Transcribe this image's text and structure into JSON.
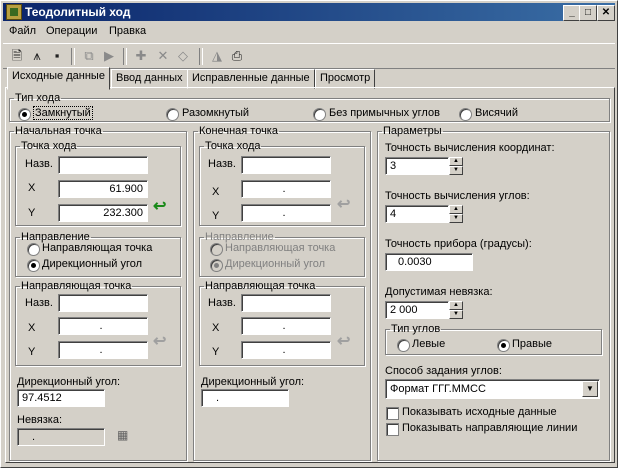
{
  "window": {
    "title": "Теодолитный ход",
    "min": "_",
    "max": "□",
    "close": "✕"
  },
  "menu": {
    "file": "Файл",
    "ops": "Операции",
    "edit": "Правка"
  },
  "toolbar": [
    "new-doc-icon",
    "instrument-icon",
    "save-icon",
    "copy-icon",
    "paste-icon",
    "add-point-icon",
    "delete-point-icon",
    "eraser-icon",
    "mirror-icon",
    "print-icon"
  ],
  "tabs": {
    "t1": "Исходные данные",
    "t2": "Ввод данных",
    "t3": "Исправленные данные",
    "t4": "Просмотр"
  },
  "course": {
    "legend": "Тип хода",
    "closed": "Замкнутый",
    "open": "Разомкнутый",
    "noangles": "Без примычных углов",
    "hanging": "Висячий",
    "selected": "closed"
  },
  "start": {
    "legend": "Начальная точка",
    "point_legend": "Точка хода",
    "name_label": "Назв.",
    "name_value": "",
    "x_label": "X",
    "x_value": "61.900",
    "y_label": "Y",
    "y_value": "232.300",
    "dir_legend": "Направление",
    "dir_guide": "Направляющая точка",
    "dir_azimuth": "Дирекционный угол",
    "guide_legend": "Направляющая точка",
    "g_name": "Назв.",
    "g_x": "X",
    "g_y": "Y",
    "g_x_value": ".",
    "g_y_value": ".",
    "azimuth_label": "Дирекционный угол:",
    "azimuth_value": "97.4512",
    "misclose_label": "Невязка:",
    "misclose_value": "."
  },
  "end": {
    "legend": "Конечная точка",
    "point_legend": "Точка хода",
    "name_label": "Назв.",
    "x_label": "X",
    "y_label": "Y",
    "x_value": ".",
    "y_value": ".",
    "dir_legend": "Направление",
    "dir_guide": "Направляющая точка",
    "dir_azimuth": "Дирекционный угол",
    "guide_legend": "Направляющая точка",
    "g_name": "Назв.",
    "g_x": "X",
    "g_y": "Y",
    "g_x_value": ".",
    "g_y_value": ".",
    "azimuth_label": "Дирекционный угол:",
    "azimuth_value": "."
  },
  "params": {
    "legend": "Параметры",
    "coord_prec_label": "Точность вычисления координат:",
    "coord_prec_value": "3",
    "angle_prec_label": "Точность вычисления углов:",
    "angle_prec_value": "4",
    "instr_label": "Точность прибора (градусы):",
    "instr_value": "0.0030",
    "tol_label": "Допустимая невязка:",
    "tol_value": "2 000",
    "angle_type_legend": "Тип углов",
    "left": "Левые",
    "right": "Правые",
    "method_label": "Способ задания углов:",
    "method_value": "Формат ГГГ.ММСС",
    "show_src": "Показывать исходные данные",
    "show_guides": "Показывать направляющие линии"
  }
}
